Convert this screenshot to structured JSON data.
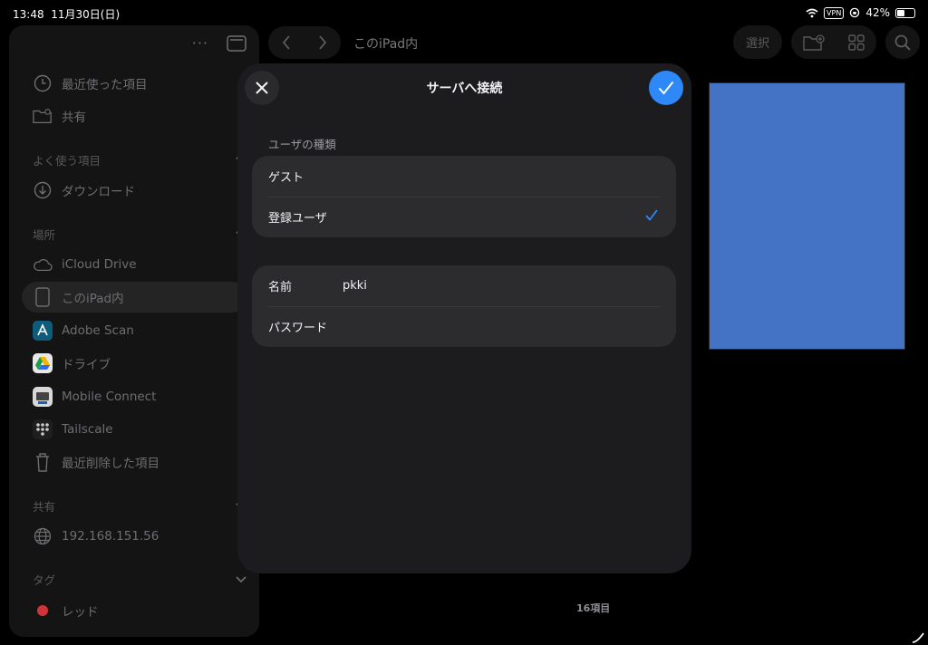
{
  "status": {
    "time": "13:48",
    "date": "11月30日(日)",
    "vpn": "VPN",
    "battery_text": "42%",
    "battery_level": 0.42
  },
  "sidebar": {
    "items": [
      {
        "label": "最近使った項目",
        "icon": "clock-icon"
      },
      {
        "label": "共有",
        "icon": "shared-folder-icon"
      },
      {
        "label": "ダウンロード",
        "icon": "download-icon"
      },
      {
        "label": "iCloud Drive",
        "icon": "cloud-icon"
      },
      {
        "label": "このiPad内",
        "icon": "ipad-icon"
      },
      {
        "label": "Adobe Scan",
        "icon": "adobe-scan-icon"
      },
      {
        "label": "ドライブ",
        "icon": "google-drive-icon"
      },
      {
        "label": "Mobile Connect",
        "icon": "mobile-connect-icon"
      },
      {
        "label": "Tailscale",
        "icon": "tailscale-icon"
      },
      {
        "label": "最近削除した項目",
        "icon": "trash-icon"
      },
      {
        "label": "192.168.151.56",
        "icon": "globe-icon"
      },
      {
        "label": "レッド",
        "icon": "red-tag-icon"
      }
    ],
    "sections": {
      "favorites": "よく使う項目",
      "locations": "場所",
      "shared": "共有",
      "tags": "タグ"
    }
  },
  "toolbar": {
    "location_title": "このiPad内",
    "select_label": "選択"
  },
  "content": {
    "item_count": "16項目"
  },
  "modal": {
    "title": "サーバへ接続",
    "user_type_header": "ユーザの種類",
    "guest_label": "ゲスト",
    "registered_label": "登録ユーザ",
    "name_label": "名前",
    "name_value": "pkki",
    "password_label": "パスワード"
  },
  "colors": {
    "accent": "#2f88f7",
    "thumbnail": "#4472c4",
    "tag_red": "#d13438"
  }
}
